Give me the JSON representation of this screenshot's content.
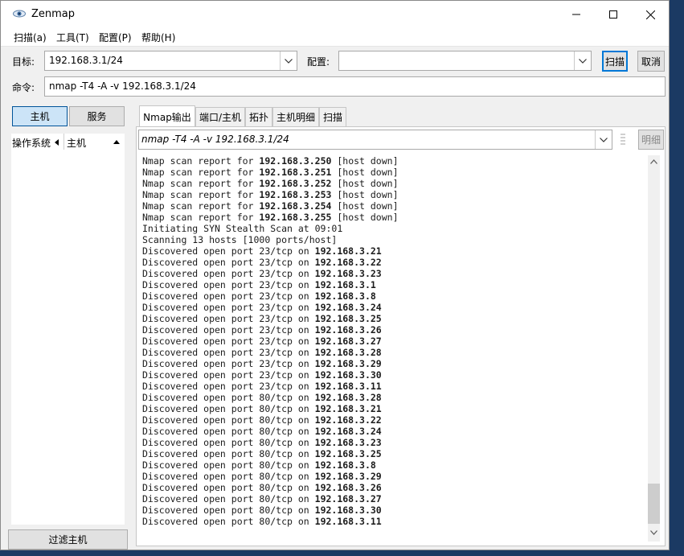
{
  "app": {
    "title": "Zenmap"
  },
  "menu": [
    "扫描(a)",
    "工具(T)",
    "配置(P)",
    "帮助(H)"
  ],
  "target": {
    "label": "目标:",
    "value": "192.168.3.1/24"
  },
  "profile": {
    "label": "配置:",
    "value": ""
  },
  "buttons": {
    "scan": "扫描",
    "cancel": "取消",
    "details": "明细",
    "filter_hosts": "过滤主机"
  },
  "command": {
    "label": "命令:",
    "value": "nmap -T4 -A -v 192.168.3.1/24"
  },
  "left": {
    "hosts_tab": "主机",
    "services_tab": "服务",
    "col_os": "操作系统",
    "col_host": "主机"
  },
  "tabs": [
    "Nmap输出",
    "端口/主机",
    "拓扑",
    "主机明细",
    "扫描"
  ],
  "output_command": "nmap -T4 -A -v 192.168.3.1/24",
  "output_lines": [
    {
      "text": "Nmap scan report for ",
      "ip": "192.168.3.250",
      "tail": " [host down]"
    },
    {
      "text": "Nmap scan report for ",
      "ip": "192.168.3.251",
      "tail": " [host down]"
    },
    {
      "text": "Nmap scan report for ",
      "ip": "192.168.3.252",
      "tail": " [host down]"
    },
    {
      "text": "Nmap scan report for ",
      "ip": "192.168.3.253",
      "tail": " [host down]"
    },
    {
      "text": "Nmap scan report for ",
      "ip": "192.168.3.254",
      "tail": " [host down]"
    },
    {
      "text": "Nmap scan report for ",
      "ip": "192.168.3.255",
      "tail": " [host down]"
    },
    {
      "text": "Initiating SYN Stealth Scan at 09:01",
      "ip": "",
      "tail": ""
    },
    {
      "text": "Scanning 13 hosts [1000 ports/host]",
      "ip": "",
      "tail": ""
    },
    {
      "text": "Discovered open port 23/tcp on ",
      "ip": "192.168.3.21",
      "tail": ""
    },
    {
      "text": "Discovered open port 23/tcp on ",
      "ip": "192.168.3.22",
      "tail": ""
    },
    {
      "text": "Discovered open port 23/tcp on ",
      "ip": "192.168.3.23",
      "tail": ""
    },
    {
      "text": "Discovered open port 23/tcp on ",
      "ip": "192.168.3.1",
      "tail": ""
    },
    {
      "text": "Discovered open port 23/tcp on ",
      "ip": "192.168.3.8",
      "tail": ""
    },
    {
      "text": "Discovered open port 23/tcp on ",
      "ip": "192.168.3.24",
      "tail": ""
    },
    {
      "text": "Discovered open port 23/tcp on ",
      "ip": "192.168.3.25",
      "tail": ""
    },
    {
      "text": "Discovered open port 23/tcp on ",
      "ip": "192.168.3.26",
      "tail": ""
    },
    {
      "text": "Discovered open port 23/tcp on ",
      "ip": "192.168.3.27",
      "tail": ""
    },
    {
      "text": "Discovered open port 23/tcp on ",
      "ip": "192.168.3.28",
      "tail": ""
    },
    {
      "text": "Discovered open port 23/tcp on ",
      "ip": "192.168.3.29",
      "tail": ""
    },
    {
      "text": "Discovered open port 23/tcp on ",
      "ip": "192.168.3.30",
      "tail": ""
    },
    {
      "text": "Discovered open port 23/tcp on ",
      "ip": "192.168.3.11",
      "tail": ""
    },
    {
      "text": "Discovered open port 80/tcp on ",
      "ip": "192.168.3.28",
      "tail": ""
    },
    {
      "text": "Discovered open port 80/tcp on ",
      "ip": "192.168.3.21",
      "tail": ""
    },
    {
      "text": "Discovered open port 80/tcp on ",
      "ip": "192.168.3.22",
      "tail": ""
    },
    {
      "text": "Discovered open port 80/tcp on ",
      "ip": "192.168.3.24",
      "tail": ""
    },
    {
      "text": "Discovered open port 80/tcp on ",
      "ip": "192.168.3.23",
      "tail": ""
    },
    {
      "text": "Discovered open port 80/tcp on ",
      "ip": "192.168.3.25",
      "tail": ""
    },
    {
      "text": "Discovered open port 80/tcp on ",
      "ip": "192.168.3.8",
      "tail": ""
    },
    {
      "text": "Discovered open port 80/tcp on ",
      "ip": "192.168.3.29",
      "tail": ""
    },
    {
      "text": "Discovered open port 80/tcp on ",
      "ip": "192.168.3.26",
      "tail": ""
    },
    {
      "text": "Discovered open port 80/tcp on ",
      "ip": "192.168.3.27",
      "tail": ""
    },
    {
      "text": "Discovered open port 80/tcp on ",
      "ip": "192.168.3.30",
      "tail": ""
    },
    {
      "text": "Discovered open port 80/tcp on ",
      "ip": "192.168.3.11",
      "tail": ""
    }
  ]
}
